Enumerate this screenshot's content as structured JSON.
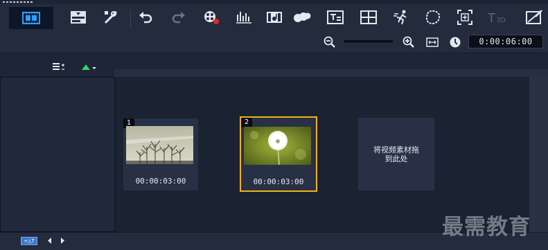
{
  "toolbar": {
    "buttons": [
      {
        "name": "storyboard-view-icon",
        "active": true
      },
      {
        "name": "timeline-view-icon"
      },
      {
        "name": "tools-icon"
      },
      {
        "name": "undo-icon"
      },
      {
        "name": "redo-icon"
      },
      {
        "name": "record-capture-icon"
      },
      {
        "name": "audio-mixer-icon"
      },
      {
        "name": "auto-music-icon"
      },
      {
        "name": "motion-tracking-icon"
      },
      {
        "name": "subtitle-editor-icon"
      },
      {
        "name": "multi-camera-icon"
      },
      {
        "name": "time-remapping-icon"
      },
      {
        "name": "mask-creator-icon"
      },
      {
        "name": "pan-zoom-icon"
      },
      {
        "name": "3d-title-editor-icon",
        "disabled": true
      },
      {
        "name": "split-screen-icon"
      }
    ]
  },
  "zoom": {
    "timecode": "0:00:06:00"
  },
  "clips": [
    {
      "number": "1",
      "duration": "00:00:03:00",
      "thumbnail": "trees-in-fog",
      "selected": false
    },
    {
      "number": "2",
      "duration": "00:00:03:00",
      "thumbnail": "dandelion-seed-head",
      "selected": true
    }
  ],
  "drop_zone": {
    "text": "将视频素材拖到此处"
  },
  "bottom": {
    "add_track_label": "+△T"
  },
  "watermark": "最需教育",
  "colors": {
    "background": "#1d2434",
    "panel": "#283045",
    "selection": "#f4b21a",
    "accent_green": "#2fd36a",
    "record_red": "#e0262c"
  }
}
